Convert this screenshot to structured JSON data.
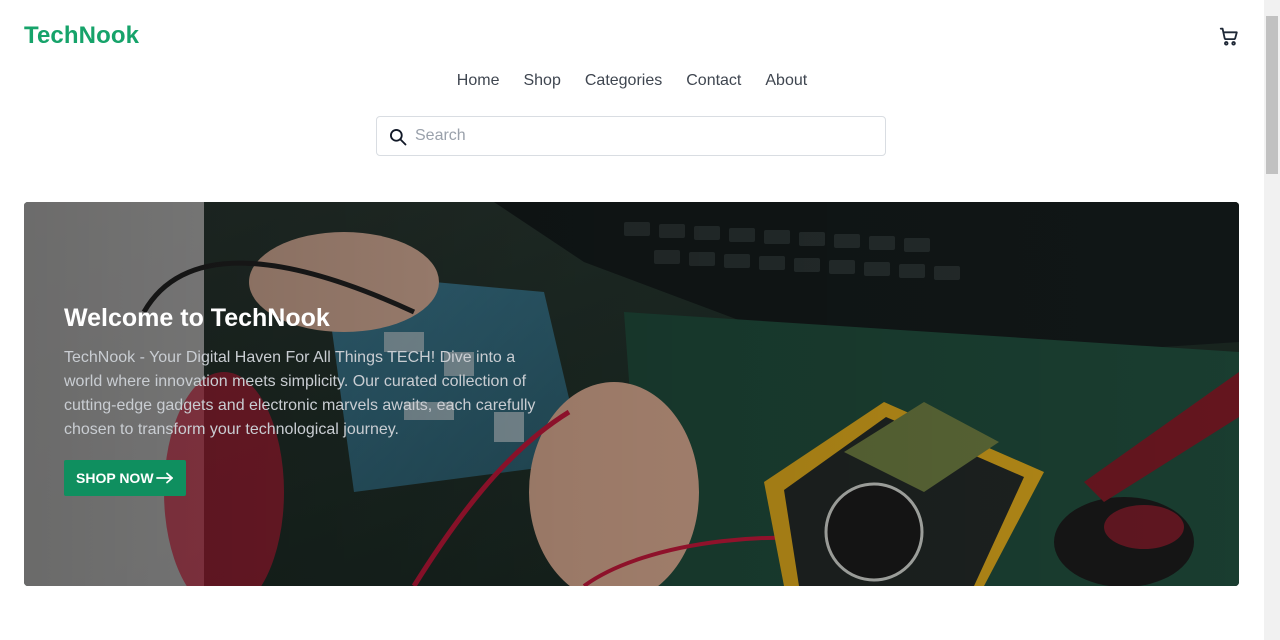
{
  "brand": {
    "name": "TechNook",
    "color": "#16a36a"
  },
  "header": {
    "cart_icon": "cart-icon"
  },
  "nav": {
    "items": [
      {
        "label": "Home"
      },
      {
        "label": "Shop"
      },
      {
        "label": "Categories"
      },
      {
        "label": "Contact"
      },
      {
        "label": "About"
      }
    ]
  },
  "search": {
    "icon": "search-icon",
    "placeholder": "Search",
    "value": ""
  },
  "hero": {
    "title": "Welcome to TechNook",
    "description": "TechNook - Your Digital Haven For All Things TECH! Dive into a world where innovation meets simplicity. Our curated collection of cutting-edge gadgets and electronic marvels awaits, each carefully chosen to transform your technological journey.",
    "cta_label": "SHOP NOW",
    "cta_icon": "arrow-right-icon",
    "cta_color": "#0f8f5f"
  }
}
